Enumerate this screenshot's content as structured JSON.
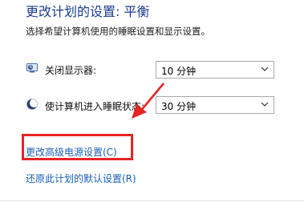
{
  "header": {
    "title": "更改计划的设置: 平衡",
    "subtitle": "选择希望计算机使用的睡眠设置和显示设置。"
  },
  "settings": {
    "display_off": {
      "label": "关闭显示器:",
      "value": "10 分钟",
      "icon": "monitor-icon"
    },
    "sleep": {
      "label": "使计算机进入睡眠状态:",
      "value": "30 分钟",
      "icon": "moon-icon"
    }
  },
  "links": {
    "advanced": "更改高级电源设置(C)",
    "restore": "还原此计划的默认设置(R)"
  },
  "annotation": {
    "highlight_color": "#e62424",
    "arrow_color": "#e62424"
  },
  "colors": {
    "title": "#1c3c8c",
    "link": "#1a5fb4"
  }
}
